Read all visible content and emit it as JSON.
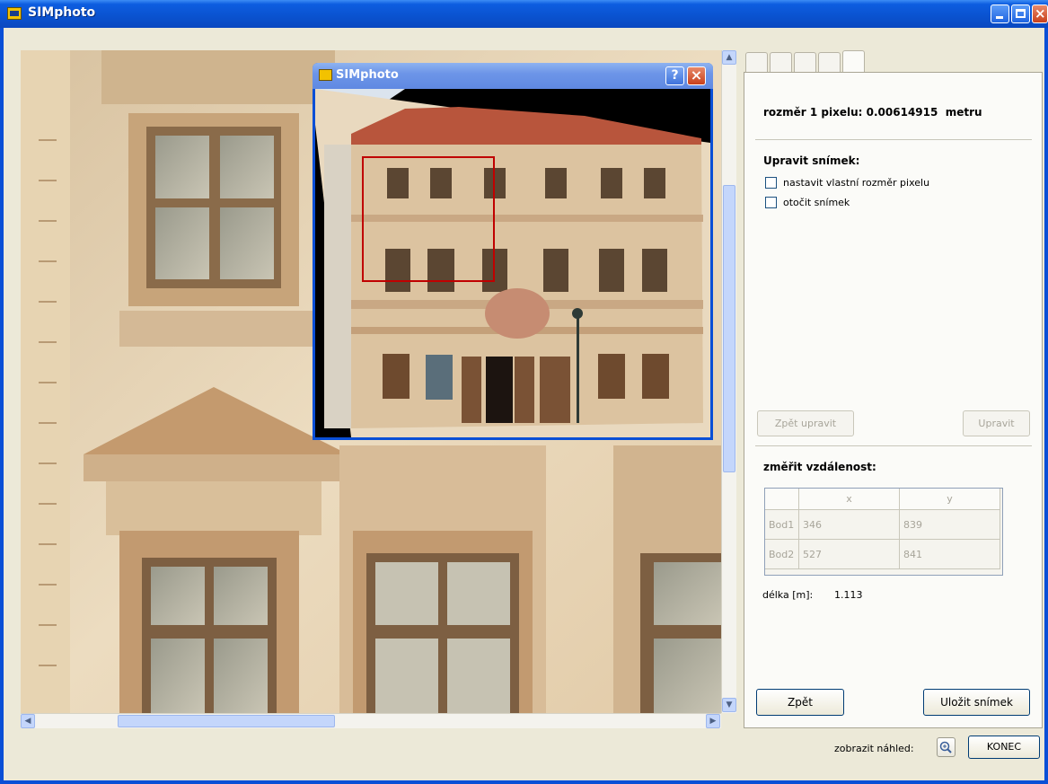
{
  "window": {
    "title": "SIMphoto"
  },
  "popup": {
    "title": "SIMphoto",
    "help_glyph": "?",
    "close_glyph": "×"
  },
  "panel": {
    "pixel_size_label": "rozměr 1 pixelu:",
    "pixel_size_value": "0.00614915",
    "pixel_size_unit": "metru",
    "edit_heading": "Upravit snímek:",
    "checkbox_custom_pixel": "nastavit vlastní rozměr pixelu",
    "checkbox_rotate": "otočit snímek",
    "undo_edit_button": "Zpět upravit",
    "edit_button": "Upravit",
    "measure_heading": "změřit vzdálenost:",
    "table": {
      "columns": [
        "x",
        "y"
      ],
      "rows": [
        {
          "label": "Bod1",
          "x": "346",
          "y": "839"
        },
        {
          "label": "Bod2",
          "x": "527",
          "y": "841"
        }
      ]
    },
    "length_label": "délka [m]:",
    "length_value": "1.113",
    "back_button": "Zpět",
    "save_button": "Uložit snímek"
  },
  "footer": {
    "preview_label": "zobrazit náhled:",
    "end_button": "KONEC"
  },
  "icons": {
    "app": "app-icon",
    "zoom": "magnifier-icon"
  },
  "colors": {
    "title_bar": "#0a52cf",
    "window_bg": "#ece9d8",
    "selection_rect": "#c00000"
  }
}
